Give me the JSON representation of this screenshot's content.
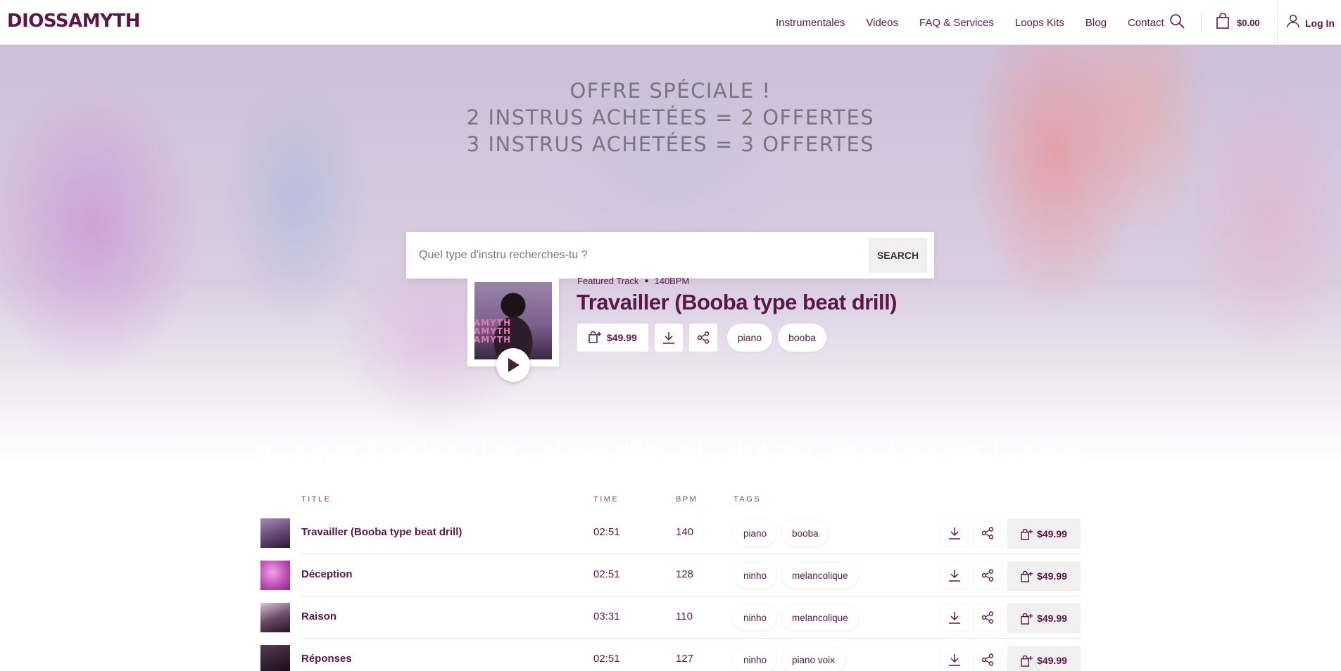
{
  "brand": {
    "logo": "DIOSSAMYTH"
  },
  "nav": {
    "items": [
      "Instrumentales",
      "Videos",
      "FAQ & Services",
      "Loops Kits",
      "Blog",
      "Contact"
    ],
    "cart_amount": "$0.00",
    "login_label": "Log In"
  },
  "hero": {
    "offer_lines": [
      "OFFRE SPÉCIALE !",
      "2 INSTRUS ACHETÉES = 2 OFFERTES",
      "3 INSTRUS ACHETÉES = 3 OFFERTES"
    ],
    "search": {
      "placeholder": "Quel type d'instru recherches-tu ?",
      "button": "SEARCH"
    },
    "featured": {
      "label": "Featured Track",
      "bpm": "140BPM",
      "title": "Travailler (Booba type beat drill)",
      "price": "$49.99",
      "tags": [
        "piano",
        "booba"
      ],
      "art_text": "AMYTH"
    }
  },
  "tracklist": {
    "headers": {
      "title": "TITLE",
      "time": "TIME",
      "bpm": "BPM",
      "tags": "TAGS"
    },
    "tracks": [
      {
        "title": "Travailler (Booba type beat drill)",
        "time": "02:51",
        "bpm": "140",
        "tags": [
          "piano",
          "booba"
        ],
        "price": "$49.99"
      },
      {
        "title": "Déception",
        "time": "02:51",
        "bpm": "128",
        "tags": [
          "ninho",
          "melancolique"
        ],
        "price": "$49.99"
      },
      {
        "title": "Raison",
        "time": "03:31",
        "bpm": "110",
        "tags": [
          "ninho",
          "melancolique"
        ],
        "price": "$49.99"
      },
      {
        "title": "Réponses",
        "time": "02:51",
        "bpm": "127",
        "tags": [
          "ninho",
          "piano voix"
        ],
        "price": "$49.99"
      }
    ]
  },
  "colors": {
    "brand": "#5a1848",
    "button_bg": "#f1eff0",
    "offer_text": "#6d6670"
  },
  "icons": [
    "search-icon",
    "cart-icon",
    "user-icon",
    "play-icon",
    "cart-plus-icon",
    "download-icon",
    "share-icon"
  ]
}
